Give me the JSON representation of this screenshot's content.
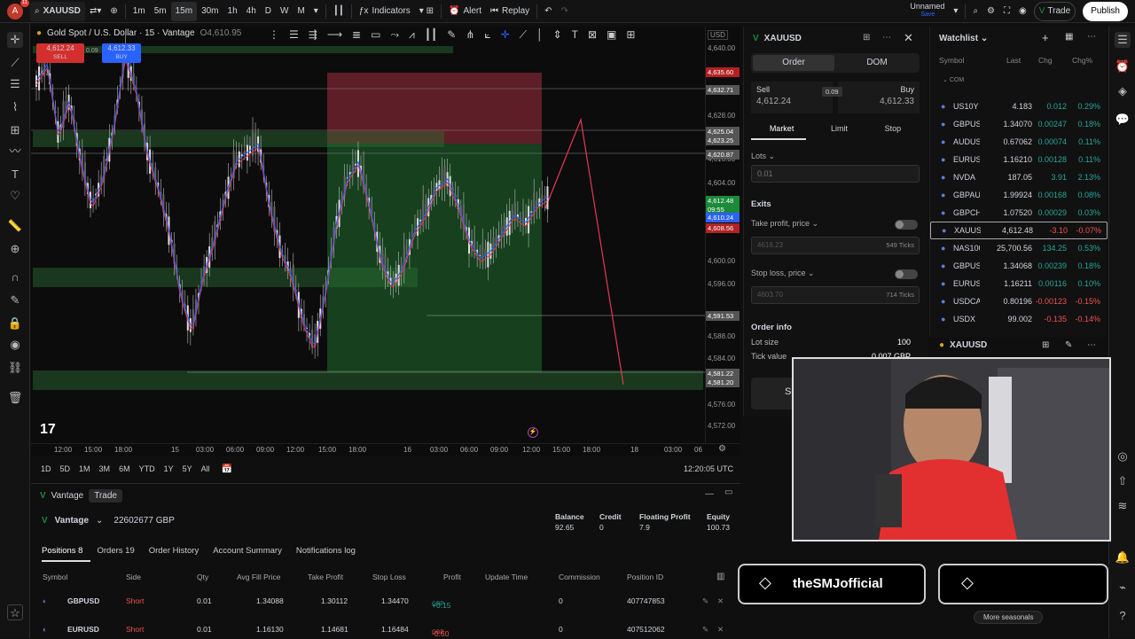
{
  "topbar": {
    "avatar_letter": "A",
    "avatar_badge": "11",
    "symbol": "XAUUSD",
    "intervals": [
      "1m",
      "5m",
      "15m",
      "30m",
      "1h",
      "4h",
      "D",
      "W",
      "M"
    ],
    "active_interval": "15m",
    "indicators_label": "Indicators",
    "alert_label": "Alert",
    "replay_label": "Replay",
    "layout_name": "Unnamed",
    "layout_status": "Save",
    "trade_label": "Trade",
    "publish_label": "Publish"
  },
  "chart": {
    "title": "Gold Spot / U.S. Dollar · 15 · Vantage",
    "ohlc_open": "O4,610.95",
    "sell_price": "4,612.24",
    "sell_label": "SELL",
    "spread": "0.09",
    "buy_price": "4,612.33",
    "buy_label": "BUY",
    "indicator_count": "3",
    "currency": "USD",
    "price_labels": [
      "4,640.00",
      "4,628.00",
      "4,616.00",
      "4,604.00",
      "4,600.00",
      "4,596.00",
      "4,588.00",
      "4,584.00",
      "4,576.00",
      "4,572.00"
    ],
    "price_tags": [
      {
        "text": "4,635.60",
        "color": "#b22222"
      },
      {
        "text": "4,632.71",
        "color": "#555"
      },
      {
        "text": "4,625.04",
        "color": "#555"
      },
      {
        "text": "4,623.25",
        "color": "#555"
      },
      {
        "text": "4,620.87",
        "color": "#555"
      },
      {
        "text": "4,612.48",
        "color": "#1b8a3a"
      },
      {
        "text": "09:55",
        "color": "#1b8a3a"
      },
      {
        "text": "4,610.24",
        "color": "#2962ff"
      },
      {
        "text": "4,608.56",
        "color": "#b22222"
      },
      {
        "text": "4,591.53",
        "color": "#555"
      },
      {
        "text": "4,581.22",
        "color": "#555"
      },
      {
        "text": "4,581.20",
        "color": "#555"
      }
    ],
    "time_labels": [
      "12:00",
      "15:00",
      "18:00",
      "15",
      "03:00",
      "06:00",
      "09:00",
      "12:00",
      "15:00",
      "18:00",
      "16",
      "03:00",
      "06:00",
      "09:00",
      "12:00",
      "15:00",
      "18:00",
      "18",
      "03:00",
      "06"
    ],
    "ranges": [
      "1D",
      "5D",
      "1M",
      "3M",
      "6M",
      "YTD",
      "1Y",
      "5Y",
      "All"
    ],
    "clock": "12:20:05 UTC"
  },
  "account": {
    "broker": "Vantage",
    "tab_trade": "Trade",
    "account_id": "22602677 GBP",
    "balance_label": "Balance",
    "balance": "92.65",
    "credit_label": "Credit",
    "credit": "0",
    "floating_label": "Floating Profit",
    "floating": "7.9",
    "equity_label": "Equity",
    "equity": "100.73",
    "tabs": [
      "Positions 8",
      "Orders 19",
      "Order History",
      "Account Summary",
      "Notifications log"
    ],
    "columns": [
      "Symbol",
      "Side",
      "Qty",
      "Avg Fill Price",
      "Take Profit",
      "Stop Loss",
      "Profit",
      "Update Time",
      "Commission",
      "Position ID"
    ],
    "rows": [
      {
        "symbol": "GBPUSD",
        "side": "Short",
        "qty": "0.01",
        "avg": "1.34088",
        "tp": "1.30112",
        "sl": "1.34470",
        "profit": "+0.15",
        "cur": "GBP",
        "commission": "0",
        "id": "407747853",
        "pcolor": "#26a69a"
      },
      {
        "symbol": "EURUSD",
        "side": "Short",
        "qty": "0.01",
        "avg": "1.16130",
        "tp": "1.14681",
        "sl": "1.16484",
        "profit": "-0.60",
        "cur": "GBP",
        "commission": "0",
        "id": "407512062",
        "pcolor": "#ef5350"
      }
    ]
  },
  "order": {
    "symbol": "XAUUSD",
    "tab_order": "Order",
    "tab_dom": "DOM",
    "sell_label": "Sell",
    "sell_price": "4,612.24",
    "buy_label": "Buy",
    "buy_price": "4,612.33",
    "spread": "0.09",
    "types": [
      "Market",
      "Limit",
      "Stop"
    ],
    "lots_label": "Lots",
    "lots_value": "0.01",
    "exits_label": "Exits",
    "tp_label": "Take profit, price",
    "tp_placeholder": "4616.23",
    "tp_ticks": "549 Ticks",
    "sl_label": "Stop loss, price",
    "sl_placeholder": "4603.70",
    "sl_ticks": "714 Ticks",
    "info_label": "Order info",
    "lot_size_label": "Lot size",
    "lot_size": "100",
    "tick_value_label": "Tick value",
    "tick_value": "0.007 GBP",
    "submit_label": "Sell"
  },
  "watchlist": {
    "title": "Watchlist",
    "cols": [
      "Symbol",
      "Last",
      "Chg",
      "Chg%"
    ],
    "section": "COM",
    "rows": [
      {
        "sym": "US10Y",
        "last": "4.183",
        "chg": "0.012",
        "pct": "0.29%",
        "c": "#26a69a"
      },
      {
        "sym": "GBPUSD",
        "last": "1.34070",
        "chg": "0.00247",
        "pct": "0.18%",
        "c": "#26a69a"
      },
      {
        "sym": "AUDUSD",
        "last": "0.67062",
        "chg": "0.00074",
        "pct": "0.11%",
        "c": "#26a69a"
      },
      {
        "sym": "EURUSD",
        "last": "1.16210",
        "chg": "0.00128",
        "pct": "0.11%",
        "c": "#26a69a"
      },
      {
        "sym": "NVDA",
        "last": "187.05",
        "chg": "3.91",
        "pct": "2.13%",
        "c": "#26a69a"
      },
      {
        "sym": "GBPAUD",
        "last": "1.99924",
        "chg": "0.00168",
        "pct": "0.08%",
        "c": "#26a69a"
      },
      {
        "sym": "GBPCHF",
        "last": "1.07520",
        "chg": "0.00029",
        "pct": "0.03%",
        "c": "#26a69a"
      },
      {
        "sym": "XAUUSD",
        "last": "4,612.48",
        "chg": "-3.10",
        "pct": "-0.07%",
        "c": "#ef5350"
      },
      {
        "sym": "NAS100",
        "last": "25,700.56",
        "chg": "134.25",
        "pct": "0.53%",
        "c": "#26a69a"
      },
      {
        "sym": "GBPUSD",
        "last": "1.34068",
        "chg": "0.00239",
        "pct": "0.18%",
        "c": "#26a69a"
      },
      {
        "sym": "EURUSD",
        "last": "1.16211",
        "chg": "0.00116",
        "pct": "0.10%",
        "c": "#26a69a"
      },
      {
        "sym": "USDCAD",
        "last": "0.80196",
        "chg": "-0.00123",
        "pct": "-0.15%",
        "c": "#ef5350"
      },
      {
        "sym": "USDX",
        "last": "99.002",
        "chg": "-0.135",
        "pct": "-0.14%",
        "c": "#ef5350"
      }
    ],
    "detail_symbol": "XAUUSD",
    "more": "More seasonals"
  },
  "overlay": {
    "channel": "theSMJofficial"
  }
}
